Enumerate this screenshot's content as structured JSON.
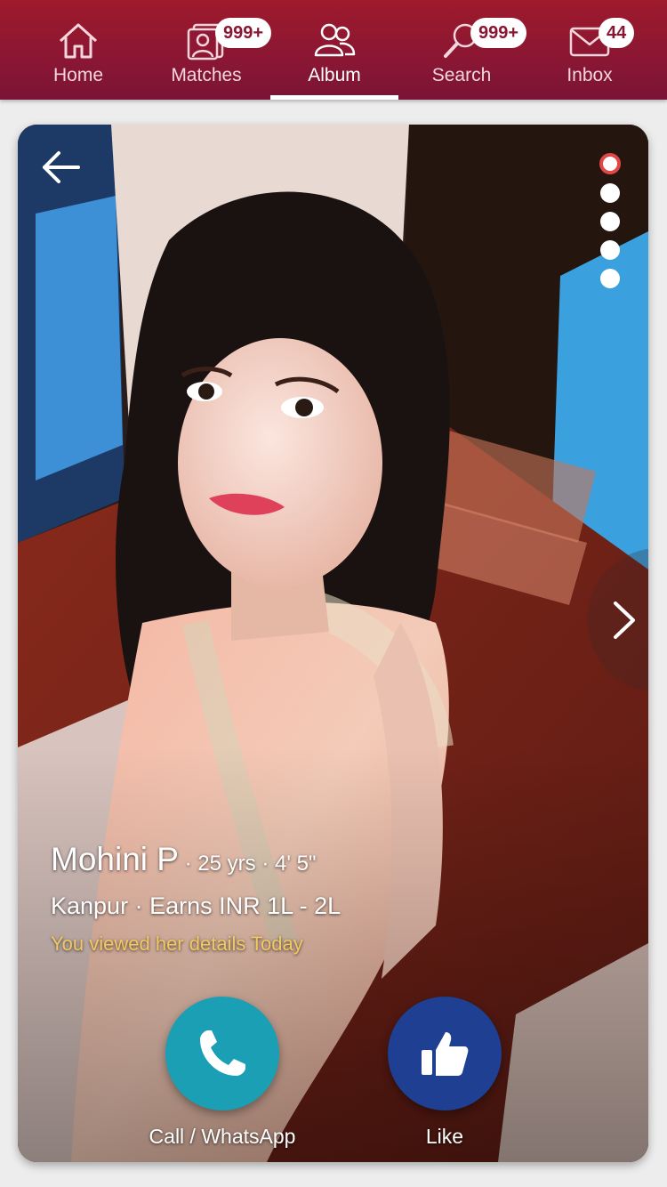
{
  "nav": {
    "items": [
      {
        "label": "Home",
        "icon": "home-icon",
        "badge": ""
      },
      {
        "label": "Matches",
        "icon": "matches-icon",
        "badge": "999+"
      },
      {
        "label": "Album",
        "icon": "album-icon",
        "badge": ""
      },
      {
        "label": "Search",
        "icon": "search-icon",
        "badge": "999+"
      },
      {
        "label": "Inbox",
        "icon": "inbox-icon",
        "badge": "44"
      }
    ],
    "active": "Album",
    "colors": {
      "bar": "#8a1633",
      "badge_text": "#8a1633"
    }
  },
  "profile": {
    "name": "Mohini P",
    "age": "25 yrs",
    "height": "4' 5\"",
    "city": "Kanpur",
    "income": "Earns INR 1L - 2L",
    "viewed_note": "You viewed her details Today"
  },
  "gallery": {
    "photo_count": 5,
    "current_photo": 1
  },
  "actions": {
    "call_label": "Call / WhatsApp",
    "like_label": "Like",
    "call_color": "#1a9fb5",
    "like_color": "#1e3f92"
  }
}
